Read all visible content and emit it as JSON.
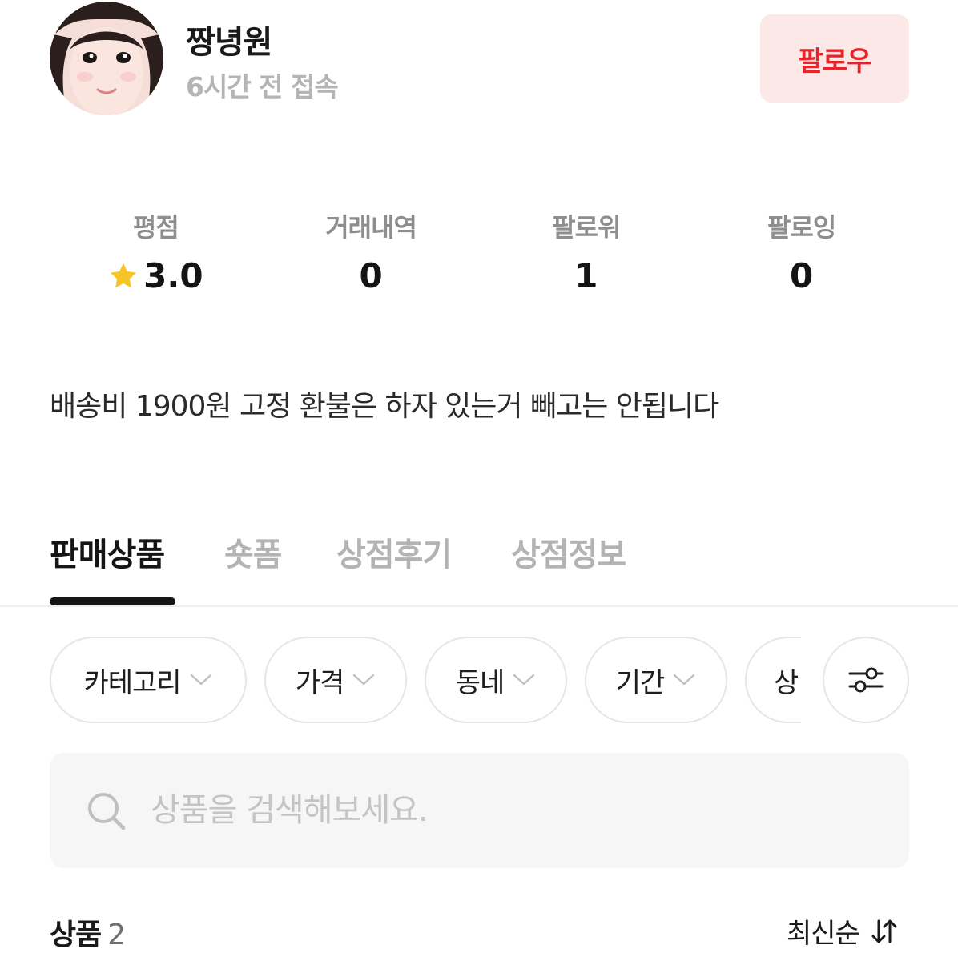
{
  "profile": {
    "name": "짱녕원",
    "last_seen": "6시간 전 접속",
    "follow_label": "팔로우"
  },
  "stats": [
    {
      "label": "평점",
      "value": "3.0",
      "icon": "star-icon"
    },
    {
      "label": "거래내역",
      "value": "0"
    },
    {
      "label": "팔로워",
      "value": "1"
    },
    {
      "label": "팔로잉",
      "value": "0"
    }
  ],
  "bio": "배송비 1900원 고정 환불은 하자 있는거 빼고는 안됩니다",
  "tabs": [
    {
      "label": "판매상품",
      "active": true
    },
    {
      "label": "숏폼",
      "active": false
    },
    {
      "label": "상점후기",
      "active": false
    },
    {
      "label": "상점정보",
      "active": false
    }
  ],
  "filters": {
    "chips": [
      {
        "label": "카테고리",
        "icon": "chevron-down-icon"
      },
      {
        "label": "가격",
        "icon": "chevron-down-icon"
      },
      {
        "label": "동네",
        "icon": "chevron-down-icon"
      },
      {
        "label": "기간",
        "icon": "chevron-down-icon"
      },
      {
        "label": "상"
      }
    ],
    "settings_icon": "sliders-icon"
  },
  "search": {
    "placeholder": "상품을 검색해보세요.",
    "value": "",
    "icon": "search-icon"
  },
  "products": {
    "label": "상품",
    "count": "2",
    "sort_label": "최신순",
    "sort_icon": "sort-arrows-icon"
  },
  "colors": {
    "accent": "#e4262b",
    "follow_bg": "#fde8e8",
    "star": "#f7c325"
  }
}
